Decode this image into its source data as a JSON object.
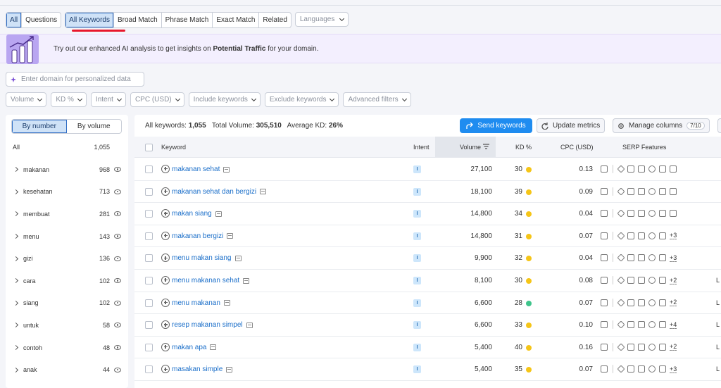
{
  "tabs": {
    "group1": [
      "All",
      "Questions"
    ],
    "group2": [
      "All Keywords",
      "Broad Match",
      "Phrase Match",
      "Exact Match",
      "Related"
    ],
    "languages": "Languages"
  },
  "banner": {
    "text_before": "Try out our enhanced AI analysis to get insights on ",
    "text_bold": "Potential Traffic",
    "text_after": " for your domain."
  },
  "domain_placeholder": "Enter domain for personalized data",
  "filters": [
    "Volume",
    "KD %",
    "Intent",
    "CPC (USD)",
    "Include keywords",
    "Exclude keywords",
    "Advanced filters"
  ],
  "sidebar": {
    "toggle": [
      "By number",
      "By volume"
    ],
    "all_label": "All",
    "all_count": "1,055",
    "items": [
      {
        "label": "makanan",
        "count": "968"
      },
      {
        "label": "kesehatan",
        "count": "713"
      },
      {
        "label": "membuat",
        "count": "281"
      },
      {
        "label": "menu",
        "count": "143"
      },
      {
        "label": "gizi",
        "count": "136"
      },
      {
        "label": "cara",
        "count": "102"
      },
      {
        "label": "siang",
        "count": "102"
      },
      {
        "label": "untuk",
        "count": "58"
      },
      {
        "label": "contoh",
        "count": "48"
      },
      {
        "label": "anak",
        "count": "44"
      }
    ]
  },
  "stats": {
    "all_label": "All keywords:",
    "all_value": "1,055",
    "vol_label": "Total Volume:",
    "vol_value": "305,510",
    "kd_label": "Average KD:",
    "kd_value": "26%"
  },
  "toolbar": {
    "send": "Send keywords",
    "update": "Update metrics",
    "manage": "Manage columns",
    "manage_badge": "7/10"
  },
  "columns": {
    "keyword": "Keyword",
    "intent": "Intent",
    "volume": "Volume",
    "kd": "KD %",
    "cpc": "CPC (USD)",
    "serp": "SERP Features"
  },
  "colors": {
    "yellow": "#f5c518",
    "green": "#3fc48b",
    "accent": "#1f8cf0"
  },
  "rows": [
    {
      "keyword": "makanan sehat",
      "intent": "I",
      "volume": "27,100",
      "kd": "30",
      "kd_color": "yellow",
      "cpc": "0.13",
      "more": "",
      "edge": ""
    },
    {
      "keyword": "makanan sehat dan bergizi",
      "intent": "I",
      "volume": "18,100",
      "kd": "39",
      "kd_color": "yellow",
      "cpc": "0.09",
      "more": "",
      "edge": ""
    },
    {
      "keyword": "makan siang",
      "intent": "I",
      "volume": "14,800",
      "kd": "34",
      "kd_color": "yellow",
      "cpc": "0.04",
      "more": "",
      "edge": ""
    },
    {
      "keyword": "makanan bergizi",
      "intent": "I",
      "volume": "14,800",
      "kd": "31",
      "kd_color": "yellow",
      "cpc": "0.07",
      "more": "+3",
      "edge": ""
    },
    {
      "keyword": "menu makan siang",
      "intent": "I",
      "volume": "9,900",
      "kd": "32",
      "kd_color": "yellow",
      "cpc": "0.04",
      "more": "+3",
      "edge": ""
    },
    {
      "keyword": "menu makanan sehat",
      "intent": "I",
      "volume": "8,100",
      "kd": "30",
      "kd_color": "yellow",
      "cpc": "0.08",
      "more": "+2",
      "edge": "L"
    },
    {
      "keyword": "menu makanan",
      "intent": "I",
      "volume": "6,600",
      "kd": "28",
      "kd_color": "green",
      "cpc": "0.07",
      "more": "+2",
      "edge": "L"
    },
    {
      "keyword": "resep makanan simpel",
      "intent": "I",
      "volume": "6,600",
      "kd": "33",
      "kd_color": "yellow",
      "cpc": "0.10",
      "more": "+4",
      "edge": "L"
    },
    {
      "keyword": "makan apa",
      "intent": "I",
      "volume": "5,400",
      "kd": "40",
      "kd_color": "yellow",
      "cpc": "0.16",
      "more": "+2",
      "edge": "L"
    },
    {
      "keyword": "masakan simple",
      "intent": "I",
      "volume": "5,400",
      "kd": "35",
      "kd_color": "yellow",
      "cpc": "0.07",
      "more": "+3",
      "edge": "L"
    }
  ]
}
